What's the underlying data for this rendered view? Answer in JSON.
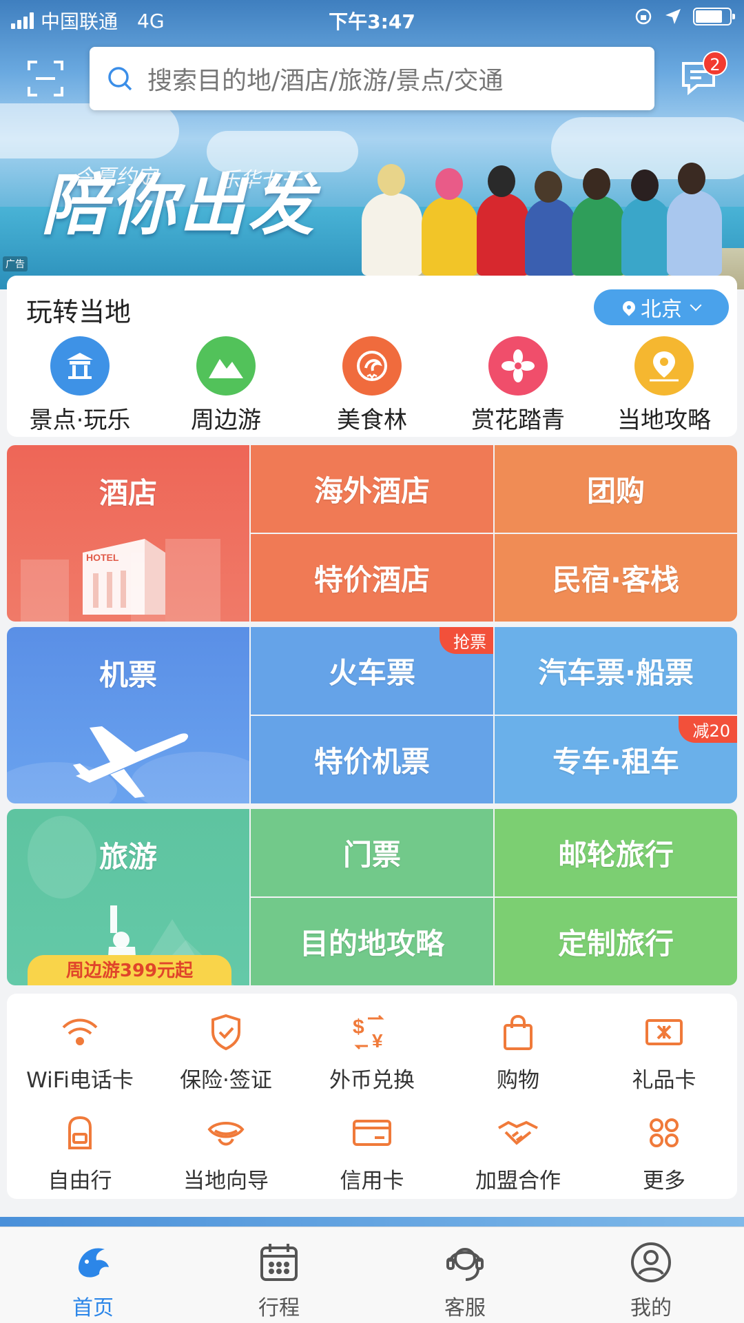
{
  "status_bar": {
    "carrier": "中国联通",
    "network": "4G",
    "time": "下午3:47"
  },
  "search": {
    "placeholder": "搜索目的地/酒店/旅游/景点/交通"
  },
  "messages": {
    "badge_count": "2"
  },
  "banner": {
    "line1": "今夏约定",
    "line2": "乐华七子",
    "slogan": "陪你出发",
    "ad_label": "广告"
  },
  "local": {
    "title": "玩转当地",
    "city": "北京",
    "items": [
      {
        "label": "景点·玩乐",
        "icon": "pavilion-icon",
        "color": "#3e92e6"
      },
      {
        "label": "周边游",
        "icon": "mountain-icon",
        "color": "#52c25a"
      },
      {
        "label": "美食林",
        "icon": "dolphin-icon",
        "color": "#f06b3d"
      },
      {
        "label": "赏花踏青",
        "icon": "flower-icon",
        "color": "#f04e6b"
      },
      {
        "label": "当地攻略",
        "icon": "map-pin-icon",
        "color": "#f5b730"
      }
    ]
  },
  "hotel_grid": {
    "main": "酒店",
    "cells": [
      "海外酒店",
      "团购",
      "特价酒店",
      "民宿·客栈"
    ]
  },
  "flight_grid": {
    "main": "机票",
    "cells": [
      "火车票",
      "汽车票·船票",
      "特价机票",
      "专车·租车"
    ],
    "tag_train": "抢票",
    "tag_car": "减20"
  },
  "travel_grid": {
    "main": "旅游",
    "promo": "周边游399元起",
    "cells": [
      "门票",
      "邮轮旅行",
      "目的地攻略",
      "定制旅行"
    ]
  },
  "services": {
    "row1": [
      {
        "label": "WiFi电话卡",
        "icon": "wifi-icon"
      },
      {
        "label": "保险·签证",
        "icon": "shield-icon"
      },
      {
        "label": "外币兑换",
        "icon": "currency-exchange-icon"
      },
      {
        "label": "购物",
        "icon": "shopping-bag-icon"
      },
      {
        "label": "礼品卡",
        "icon": "gift-card-icon"
      }
    ],
    "row2": [
      {
        "label": "自由行",
        "icon": "backpack-icon"
      },
      {
        "label": "当地向导",
        "icon": "guide-icon"
      },
      {
        "label": "信用卡",
        "icon": "credit-card-icon"
      },
      {
        "label": "加盟合作",
        "icon": "handshake-icon"
      },
      {
        "label": "更多",
        "icon": "more-grid-icon"
      }
    ]
  },
  "tabs": [
    {
      "label": "首页",
      "icon": "home-dolphin-icon",
      "active": true
    },
    {
      "label": "行程",
      "icon": "calendar-icon",
      "active": false
    },
    {
      "label": "客服",
      "icon": "headset-icon",
      "active": false
    },
    {
      "label": "我的",
      "icon": "user-icon",
      "active": false
    }
  ],
  "colors": {
    "accent": "#2c86e8",
    "hotel": "#ef6c4f",
    "flight": "#5a9be8",
    "travel": "#62c584",
    "icon_orange": "#f07a3a"
  }
}
